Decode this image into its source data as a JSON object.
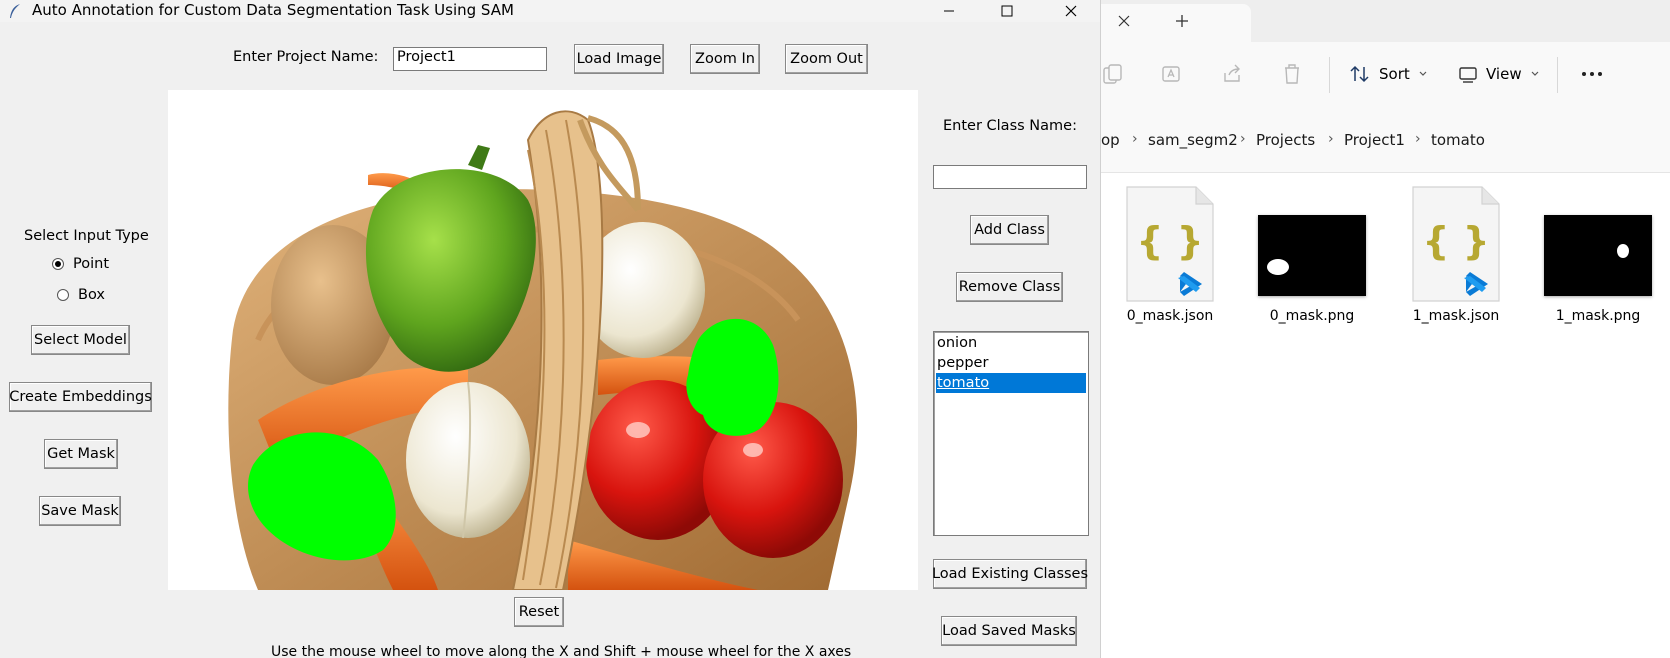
{
  "window": {
    "title": "Auto Annotation for Custom Data Segmentation Task Using SAM",
    "minimize_icon": "minimize-icon",
    "maximize_icon": "maximize-icon",
    "close_icon": "close-icon"
  },
  "toolbar": {
    "project_label": "Enter Project Name:",
    "project_value": "Project1",
    "load_image": "Load Image",
    "zoom_in": "Zoom In",
    "zoom_out": "Zoom Out"
  },
  "left_panel": {
    "input_type_label": "Select Input Type",
    "point_label": "Point",
    "box_label": "Box",
    "selected_input": "Point",
    "select_model": "Select Model",
    "create_embeddings": "Create Embeddings",
    "get_mask": "Get Mask",
    "save_mask": "Save Mask"
  },
  "right_panel": {
    "class_label": "Enter Class Name:",
    "class_value": "",
    "add_class": "Add Class",
    "remove_class": "Remove Class",
    "classes": [
      "onion",
      "pepper",
      "tomato"
    ],
    "selected_class": "tomato",
    "load_existing": "Load Existing Classes",
    "load_saved": "Load Saved Masks"
  },
  "canvas": {
    "reset": "Reset",
    "hint": "Use the mouse wheel to move along the X and Shift + mouse wheel for the X axes",
    "mask_color": "#00ff00"
  },
  "explorer": {
    "tab_close_icon": "close-icon",
    "new_tab_icon": "plus-icon",
    "sort_label": "Sort",
    "view_label": "View",
    "more_icon": "ellipsis-icon",
    "breadcrumbs": [
      "op",
      "sam_segm2",
      "Projects",
      "Project1",
      "tomato"
    ],
    "files": [
      {
        "name": "0_mask.json",
        "kind": "json"
      },
      {
        "name": "0_mask.png",
        "kind": "png"
      },
      {
        "name": "1_mask.json",
        "kind": "json"
      },
      {
        "name": "1_mask.png",
        "kind": "png"
      }
    ]
  }
}
